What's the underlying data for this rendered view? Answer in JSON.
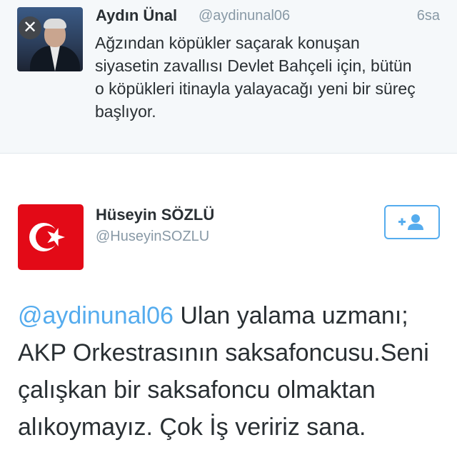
{
  "tweet1": {
    "author_name": "Aydın Ünal",
    "author_handle": "@aydinunal06",
    "time": "6sa",
    "text": "Ağzından köpükler saçarak konuşan siyasetin zavallısı Devlet Bahçeli için, bütün o köpükleri itinayla yalayacağı yeni bir süreç başlıyor.",
    "close_glyph": "✕"
  },
  "tweet2": {
    "author_name": "Hüseyin SÖZLÜ",
    "author_handle": "@HuseyinSOZLU",
    "mention": "@aydinunal06",
    "text": "Ulan yalama uzmanı; AKP Orkestrasının saksafoncusu.Seni çalışkan bir saksafoncu olmaktan alıkoymayız. Çok İş veririz sana."
  },
  "icons": {
    "close": "close-icon",
    "follow": "add-user-icon",
    "avatar_flag": "turkish-flag-icon"
  },
  "colors": {
    "link": "#55acee",
    "muted": "#8899a6",
    "text": "#292f33",
    "flag_red": "#e30a17",
    "card_background": "#f5f8fa"
  }
}
